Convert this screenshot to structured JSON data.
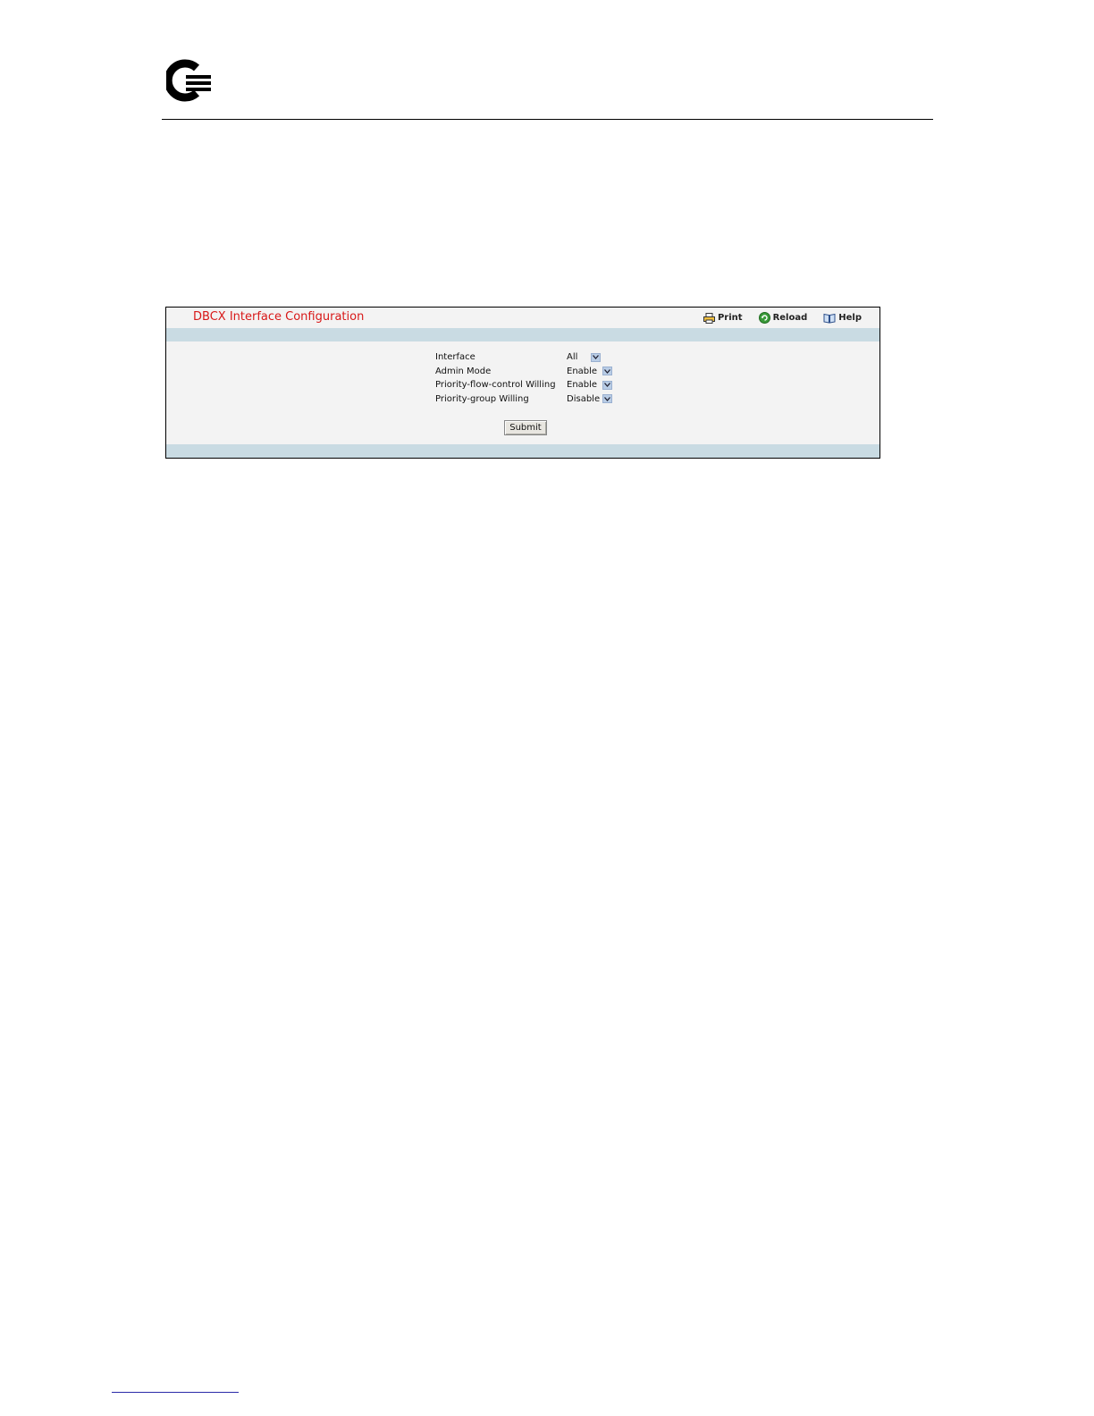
{
  "panel": {
    "title": "DBCX Interface Configuration",
    "toolbar": {
      "print_label": "Print",
      "reload_label": "Reload",
      "help_label": "Help"
    }
  },
  "form": {
    "fields": [
      {
        "label": "Interface",
        "value": "All"
      },
      {
        "label": "Admin Mode",
        "value": "Enable"
      },
      {
        "label": "Priority-flow-control Willing",
        "value": "Enable"
      },
      {
        "label": "Priority-group Willing",
        "value": "Disable"
      }
    ],
    "submit_label": "Submit"
  },
  "colors": {
    "title": "#d81818",
    "band": "#c9dbe3",
    "panel_bg": "#f3f3f3",
    "dropdown": "#b9cde6"
  },
  "icons": {
    "logo": "company-logo",
    "print": "printer-icon",
    "reload": "reload-icon",
    "help": "help-book-icon",
    "dropdown": "chevron-down-icon"
  }
}
